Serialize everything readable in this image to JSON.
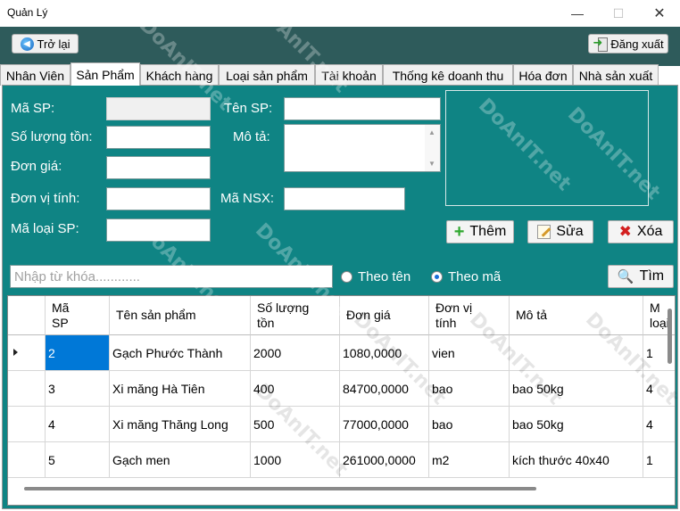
{
  "window": {
    "title": "Quản Lý",
    "controls": {
      "minimize": "—",
      "maximize": "☐",
      "close": "✕"
    }
  },
  "header": {
    "back_label": "Trở lại",
    "logout_label": "Đăng xuất"
  },
  "tabs": [
    {
      "label": "Nhân Viên",
      "active": false
    },
    {
      "label": "Sản Phẩm",
      "active": true
    },
    {
      "label": "Khách hàng",
      "active": false
    },
    {
      "label": "Loại sản phẩm",
      "active": false
    },
    {
      "label": "Tài khoản",
      "active": false
    },
    {
      "label": "Thống kê doanh thu",
      "active": false
    },
    {
      "label": "Hóa đơn",
      "active": false
    },
    {
      "label": "Nhà sản xuất",
      "active": false
    }
  ],
  "form": {
    "ma_sp_label": "Mã SP:",
    "so_luong_label": "Số lượng tồn:",
    "don_gia_label": "Đơn giá:",
    "don_vi_label": "Đơn vị tính:",
    "ma_loai_label": "Mã loại SP:",
    "ten_sp_label": "Tên SP:",
    "mo_ta_label": "Mô tả:",
    "ma_nsx_label": "Mã NSX:",
    "values": {
      "ma_sp": "",
      "so_luong": "",
      "don_gia": "",
      "don_vi": "",
      "ma_loai": "",
      "ten_sp": "",
      "mo_ta": "",
      "ma_nsx": ""
    }
  },
  "actions": {
    "add_label": "Thêm",
    "edit_label": "Sửa",
    "delete_label": "Xóa",
    "find_label": "Tìm"
  },
  "search": {
    "placeholder": "Nhập từ khóa............",
    "radio_name": "Theo tên",
    "radio_code": "Theo mã",
    "selected": "Theo mã"
  },
  "table": {
    "columns": [
      "Mã SP",
      "Tên sản phẩm",
      "Số lượng tồn",
      "Đơn giá",
      "Đơn vị tính",
      "Mô tả",
      "Mã loại"
    ],
    "column_display": [
      "Mã\nSP",
      "Tên sản phẩm",
      "Số lượng\ntồn",
      "Đơn giá",
      "Đơn vị\ntính",
      "Mô tả",
      "M\nloại"
    ],
    "rows": [
      {
        "ma": "2",
        "ten": "Gạch Phước Thành",
        "sl": "2000",
        "gia": "1080,0000",
        "dv": "vien",
        "mota": "",
        "loai": "1"
      },
      {
        "ma": "3",
        "ten": "Xi măng Hà Tiên",
        "sl": "400",
        "gia": "84700,0000",
        "dv": "bao",
        "mota": "bao 50kg",
        "loai": "4"
      },
      {
        "ma": "4",
        "ten": "Xi măng Thăng Long",
        "sl": "500",
        "gia": "77000,0000",
        "dv": "bao",
        "mota": "bao 50kg",
        "loai": "4"
      },
      {
        "ma": "5",
        "ten": "Gạch men",
        "sl": "1000",
        "gia": "261000,0000",
        "dv": "m2",
        "mota": "kích thước 40x40",
        "loai": "1"
      }
    ],
    "selected_row": 0
  },
  "watermark": "DoAnIT.net",
  "colors": {
    "panel": "#0f8484",
    "topband": "#2e5b5b",
    "selection": "#0078d7"
  }
}
